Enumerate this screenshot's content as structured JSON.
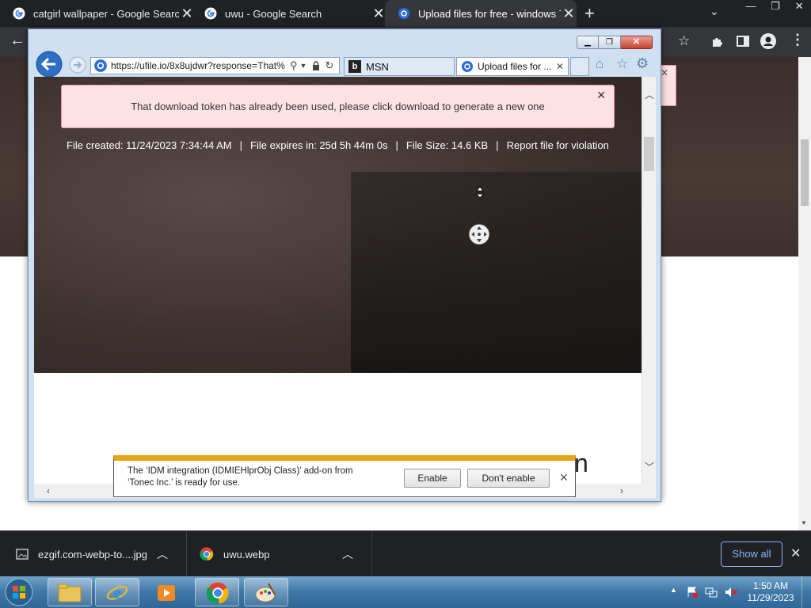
{
  "chrome": {
    "tabs": [
      {
        "title": "catgirl wallpaper - Google Search"
      },
      {
        "title": "uwu - Google Search"
      },
      {
        "title": "Upload files for free - windows 7"
      }
    ]
  },
  "ie": {
    "address": "https://ufile.io/8x8ujdwr?response=That%",
    "tabs": [
      {
        "title": "MSN"
      },
      {
        "title": "Upload files for ..."
      }
    ],
    "alert": "That download token has already been used, please click download to generate a new one",
    "fileinfo": {
      "created": "File created: 11/24/2023 7:34:44 AM",
      "expires": "File expires in: 25d 5h 44m 0s",
      "size": "File Size: 14.6 KB",
      "report": "Report file for violation",
      "sep": "|"
    },
    "partial_heading": "n",
    "notification": {
      "text_line1": "The ‘IDM integration (IDMIEHlprObj Class)’ add-on from",
      "text_line2": "‘Tonec Inc.’ is ready for use.",
      "enable": "Enable",
      "dont_enable": "Don't enable"
    }
  },
  "downloads": {
    "items": [
      {
        "name": "ezgif.com-webp-to....jpg"
      },
      {
        "name": "uwu.webp"
      }
    ],
    "show_all": "Show all"
  },
  "taskbar": {
    "time": "1:50 AM",
    "date": "11/29/2023"
  },
  "colors": {
    "chrome_bg": "#202124",
    "chrome_toolbar": "#35363a",
    "alert_bg": "#fde2e4",
    "alert_border": "#e8949c",
    "notif_accent": "#e8a317",
    "taskbar": "#3f76a6"
  }
}
